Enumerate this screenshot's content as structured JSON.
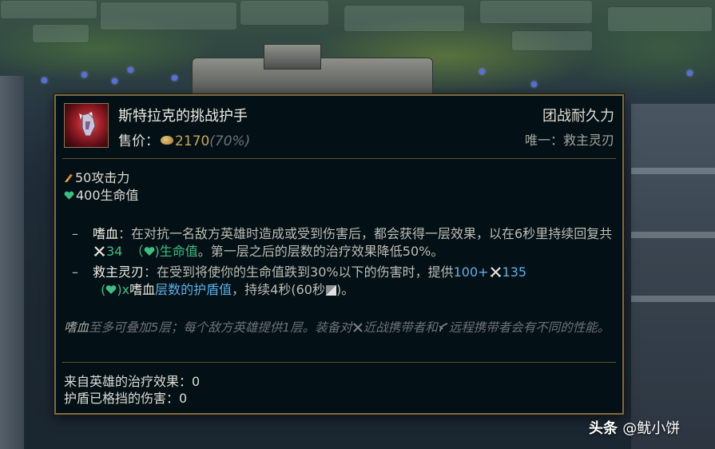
{
  "item": {
    "name": "斯特拉克的挑战护手",
    "category": "团战耐久力",
    "sell_label": "售价：",
    "sell_price": "2170",
    "sell_percent": "(70%)",
    "unique": "唯一：救主灵刃"
  },
  "stats": [
    {
      "icon": "attack-damage-icon",
      "text": "50攻击力"
    },
    {
      "icon": "health-icon",
      "text": "400生命值"
    }
  ],
  "passive_1": {
    "name": "嗜血",
    "part1": "：在对抗一名敌方英雄时造成或受到伤害后，都会获得一层效果，以在6秒里持续回复共",
    "value": "34",
    "open_paren": "（",
    "link": ")生命值",
    "part2": "。第一层之后的层数的治疗效果降低50%。"
  },
  "passive_2": {
    "name": "救主灵刃",
    "part1": "：在受到将使你的生命值跌到30%以下的伤害时，提供",
    "base": "100+",
    "value": "135",
    "open_paren": "(",
    "x_text": ")x",
    "stack_word": "嗜血",
    "shield_text": "层数的护盾值",
    "part2": "，持续4秒(60秒",
    "close": ")。"
  },
  "note": {
    "keyword": "嗜血",
    "text1": "至多可叠加5层；每个敌方英雄提供1层。装备对",
    "melee": "近战携带者和",
    "ranged": "远程携带者会有不同的性能。"
  },
  "footer": {
    "heal_line": "来自英雄的治疗效果：0",
    "shield_line": "护盾已格挡的伤害：0"
  },
  "watermark": {
    "brand": "头条",
    "handle": "@鱿小饼"
  },
  "colors": {
    "panel_bg": "#031015",
    "border_gold": "#7c6b44",
    "gold_text": "#c9a654",
    "heal_green": "#3bbf84",
    "shield_blue": "#5ab0e8"
  }
}
